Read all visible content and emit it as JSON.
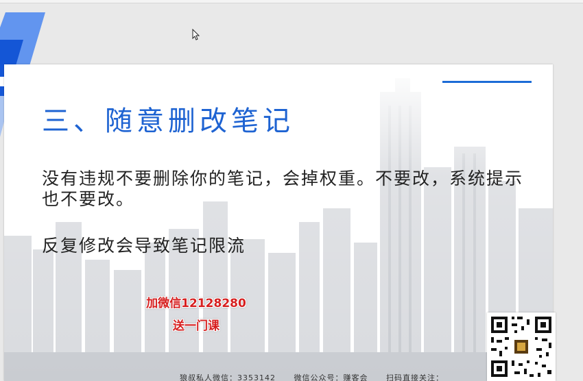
{
  "slide": {
    "title": "三、随意删改笔记",
    "paragraph_1": "没有违规不要删除你的笔记，会掉权重。不要改，系统提示也不要改。",
    "paragraph_2": "反复修改会导致笔记限流"
  },
  "promo": {
    "line_1": "加微信12128280",
    "line_2": "送一门课"
  },
  "footer": {
    "private_wechat": "狼叔私人微信：3353142",
    "official_account": "微信公众号：赚客会",
    "scan_prompt": "扫码直接关注："
  },
  "colors": {
    "title_blue": "#1e63d2",
    "accent_blue": "#1c6bd6",
    "promo_red": "#d61f1f"
  },
  "icons": {
    "cursor": "mouse-pointer-icon",
    "qr": "qr-code-icon"
  }
}
